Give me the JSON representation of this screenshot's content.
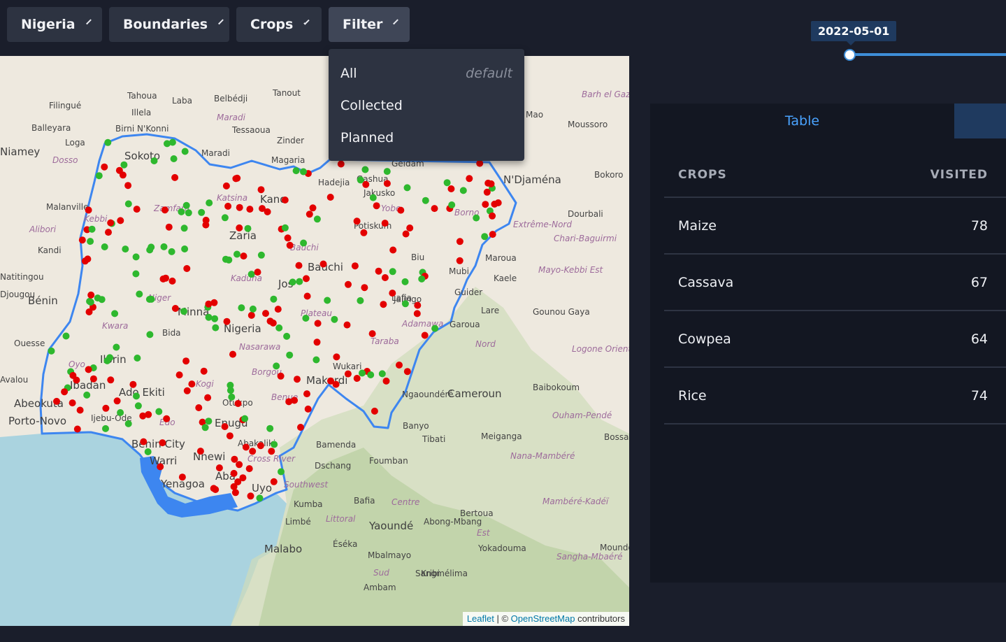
{
  "toolbar": {
    "country_label": "Nigeria",
    "boundaries_label": "Boundaries",
    "crops_label": "Crops",
    "filter_label": "Filter"
  },
  "filter_menu": {
    "items": [
      {
        "label": "All",
        "hint": "default"
      },
      {
        "label": "Collected",
        "hint": ""
      },
      {
        "label": "Planned",
        "hint": ""
      }
    ]
  },
  "slider": {
    "date": "2022-05-01"
  },
  "panel": {
    "tab_table": "Table",
    "columns": [
      "CROPS",
      "VISITED"
    ],
    "rows": [
      {
        "crop": "Maize",
        "visited": "78"
      },
      {
        "crop": "Cassava",
        "visited": "67"
      },
      {
        "crop": "Cowpea",
        "visited": "64"
      },
      {
        "crop": "Rice",
        "visited": "74"
      }
    ]
  },
  "map": {
    "attribution_leaflet": "Leaflet",
    "attribution_sep": " | © ",
    "attribution_osm": "OpenStreetMap",
    "attribution_tail": " contributors",
    "colors": {
      "collected": "#2eb82e",
      "planned": "#e30000",
      "boundary": "#3d86f0"
    },
    "labels": [
      {
        "t": "Niamey",
        "c": "country"
      },
      {
        "t": "Sokoto",
        "c": "country"
      },
      {
        "t": "Kano",
        "c": "country"
      },
      {
        "t": "Zinder",
        "c": "small"
      },
      {
        "t": "Maradi",
        "c": "small"
      },
      {
        "t": "Tahoua",
        "c": "small"
      },
      {
        "t": "Filingué",
        "c": "small"
      },
      {
        "t": "Balleyara",
        "c": "small"
      },
      {
        "t": "Loga",
        "c": "small"
      },
      {
        "t": "Dosso",
        "c": "region"
      },
      {
        "t": "Birni N'Konni",
        "c": "small"
      },
      {
        "t": "Illela",
        "c": "small"
      },
      {
        "t": "Laba",
        "c": "small"
      },
      {
        "t": "Belbédji",
        "c": "small"
      },
      {
        "t": "Tanout",
        "c": "small"
      },
      {
        "t": "Tessaoua",
        "c": "small"
      },
      {
        "t": "Magaria",
        "c": "small"
      },
      {
        "t": "Maradi",
        "c": "region"
      },
      {
        "t": "Gashua",
        "c": "small"
      },
      {
        "t": "Jakusko",
        "c": "small"
      },
      {
        "t": "Hadejia",
        "c": "small"
      },
      {
        "t": "Geidam",
        "c": "small"
      },
      {
        "t": "Yobe",
        "c": "region"
      },
      {
        "t": "Borno",
        "c": "region"
      },
      {
        "t": "Potiskum",
        "c": "small"
      },
      {
        "t": "Biu",
        "c": "small"
      },
      {
        "t": "Bauchi",
        "c": "country"
      },
      {
        "t": "Bauchi",
        "c": "region"
      },
      {
        "t": "Zaria",
        "c": "country"
      },
      {
        "t": "Katsina",
        "c": "region"
      },
      {
        "t": "Zamfara",
        "c": "region"
      },
      {
        "t": "Kebbi",
        "c": "region"
      },
      {
        "t": "Malanville",
        "c": "small"
      },
      {
        "t": "Alibori",
        "c": "region"
      },
      {
        "t": "Kandi",
        "c": "small"
      },
      {
        "t": "Kaduna",
        "c": "region"
      },
      {
        "t": "Jos",
        "c": "country"
      },
      {
        "t": "Plateau",
        "c": "region"
      },
      {
        "t": "Minna",
        "c": "country"
      },
      {
        "t": "Niger",
        "c": "region"
      },
      {
        "t": "Nigeria",
        "c": "country"
      },
      {
        "t": "Nasarawa",
        "c": "region"
      },
      {
        "t": "Bida",
        "c": "small"
      },
      {
        "t": "Kwara",
        "c": "region"
      },
      {
        "t": "Ilorin",
        "c": "country"
      },
      {
        "t": "Oyo",
        "c": "region"
      },
      {
        "t": "Ibadan",
        "c": "country"
      },
      {
        "t": "Ado Ekiti",
        "c": "country"
      },
      {
        "t": "Abeokuta",
        "c": "country"
      },
      {
        "t": "Ijebu-Ode",
        "c": "small"
      },
      {
        "t": "Porto-Novo",
        "c": "country"
      },
      {
        "t": "Ouesse",
        "c": "small"
      },
      {
        "t": "Bénin",
        "c": "country"
      },
      {
        "t": "Borgou",
        "c": "region"
      },
      {
        "t": "Makurdi",
        "c": "country"
      },
      {
        "t": "Wukari",
        "c": "small"
      },
      {
        "t": "Taraba",
        "c": "region"
      },
      {
        "t": "Jalingo",
        "c": "small"
      },
      {
        "t": "Adamawa",
        "c": "region"
      },
      {
        "t": "Lafia",
        "c": "small"
      },
      {
        "t": "Benue",
        "c": "region"
      },
      {
        "t": "Otukpo",
        "c": "small"
      },
      {
        "t": "Enugu",
        "c": "country"
      },
      {
        "t": "Abakaliki",
        "c": "small"
      },
      {
        "t": "Cross River",
        "c": "region"
      },
      {
        "t": "Benin City",
        "c": "country"
      },
      {
        "t": "Edo",
        "c": "region"
      },
      {
        "t": "Kogi",
        "c": "region"
      },
      {
        "t": "Nnewi",
        "c": "country"
      },
      {
        "t": "Warri",
        "c": "country"
      },
      {
        "t": "Yenagoa",
        "c": "country"
      },
      {
        "t": "Aba",
        "c": "country"
      },
      {
        "t": "Uyo",
        "c": "country"
      },
      {
        "t": "N'Djaména",
        "c": "country"
      },
      {
        "t": "Maroua",
        "c": "small"
      },
      {
        "t": "Kaele",
        "c": "small"
      },
      {
        "t": "Mubi",
        "c": "small"
      },
      {
        "t": "Guider",
        "c": "small"
      },
      {
        "t": "Garoua",
        "c": "small"
      },
      {
        "t": "Lare",
        "c": "small"
      },
      {
        "t": "Cameroun",
        "c": "country"
      },
      {
        "t": "Ngaoundéré",
        "c": "small"
      },
      {
        "t": "Banyo",
        "c": "small"
      },
      {
        "t": "Tibati",
        "c": "small"
      },
      {
        "t": "Meiganga",
        "c": "small"
      },
      {
        "t": "Bamenda",
        "c": "small"
      },
      {
        "t": "Foumban",
        "c": "small"
      },
      {
        "t": "Dschang",
        "c": "small"
      },
      {
        "t": "Kumba",
        "c": "small"
      },
      {
        "t": "Bafia",
        "c": "small"
      },
      {
        "t": "Bertoua",
        "c": "small"
      },
      {
        "t": "Yaoundé",
        "c": "country"
      },
      {
        "t": "Abong-Mbang",
        "c": "small"
      },
      {
        "t": "Limbé",
        "c": "small"
      },
      {
        "t": "Malabo",
        "c": "country"
      },
      {
        "t": "Éséka",
        "c": "small"
      },
      {
        "t": "Mbalmayo",
        "c": "small"
      },
      {
        "t": "Kribi",
        "c": "small"
      },
      {
        "t": "Sangmélima",
        "c": "small"
      },
      {
        "t": "Ambam",
        "c": "small"
      },
      {
        "t": "Yokadouma",
        "c": "small"
      },
      {
        "t": "Baibokoum",
        "c": "small"
      },
      {
        "t": "Bokoro",
        "c": "small"
      },
      {
        "t": "Dourbali",
        "c": "small"
      },
      {
        "t": "Moussoro",
        "c": "small"
      },
      {
        "t": "Mao",
        "c": "small"
      },
      {
        "t": "Gounou Gaya",
        "c": "small"
      },
      {
        "t": "Logone Oriental",
        "c": "region"
      },
      {
        "t": "Mayo-Kebbi Est",
        "c": "region"
      },
      {
        "t": "Chari-Baguirmi",
        "c": "region"
      },
      {
        "t": "Extrême-Nord",
        "c": "region"
      },
      {
        "t": "Nord",
        "c": "region"
      },
      {
        "t": "Ouham-Pendé",
        "c": "region"
      },
      {
        "t": "Nana-Mambéré",
        "c": "region"
      },
      {
        "t": "Mambéré-Kadéï",
        "c": "region"
      },
      {
        "t": "Centre",
        "c": "region"
      },
      {
        "t": "Littoral",
        "c": "region"
      },
      {
        "t": "Southwest",
        "c": "region"
      },
      {
        "t": "Est",
        "c": "region"
      },
      {
        "t": "Sud",
        "c": "region"
      },
      {
        "t": "Sangha-Mbaéré",
        "c": "region"
      },
      {
        "t": "Barh el Gazel",
        "c": "region"
      },
      {
        "t": "Avalou",
        "c": "small"
      },
      {
        "t": "Natitingou",
        "c": "small"
      },
      {
        "t": "Djougou",
        "c": "small"
      },
      {
        "t": "Bossangoa",
        "c": "small"
      },
      {
        "t": "Moundou",
        "c": "small"
      }
    ]
  }
}
